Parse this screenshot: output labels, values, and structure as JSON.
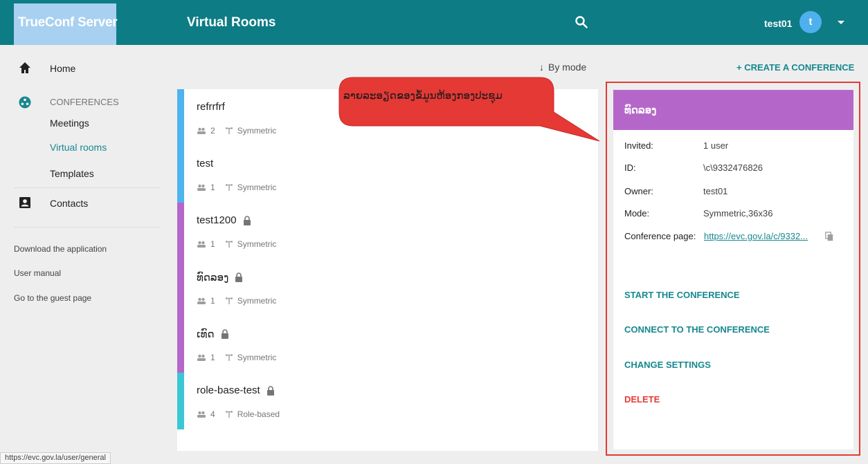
{
  "header": {
    "brand": "TrueConf Server",
    "title": "Virtual Rooms",
    "user": "test01",
    "avatar_letter": "t",
    "color": "#0d7c85",
    "brand_color": "#a8d0f0",
    "icons": [
      "search-icon",
      "dropdown-icon"
    ]
  },
  "sidebar": {
    "home": "Home",
    "conferences_section": "CONFERENCES",
    "meetings": "Meetings",
    "virtual_rooms": "Virtual rooms",
    "templates": "Templates",
    "contacts": "Contacts",
    "download": "Download the application",
    "user_manual": "User manual",
    "guest_page": "Go to the guest page",
    "icons": [
      "home-icon",
      "conferences-icon",
      "contacts-icon"
    ]
  },
  "toolbar": {
    "sort": "By mode",
    "create": "+ CREATE A CONFERENCE"
  },
  "rooms": [
    {
      "name": "refrrfrf",
      "participants": "2",
      "mode": "Symmetric",
      "locked": false,
      "color": "#4fb3ee"
    },
    {
      "name": "test",
      "participants": "1",
      "mode": "Symmetric",
      "locked": false,
      "color": "#4fb3ee"
    },
    {
      "name": "test1200",
      "participants": "1",
      "mode": "Symmetric",
      "locked": true,
      "color": "#b567c9"
    },
    {
      "name": "ທົດລອງ",
      "participants": "1",
      "mode": "Symmetric",
      "locked": true,
      "color": "#b567c9"
    },
    {
      "name": "ເທົດ",
      "participants": "1",
      "mode": "Symmetric",
      "locked": true,
      "color": "#b567c9"
    },
    {
      "name": "role-base-test",
      "participants": "4",
      "mode": "Role-based",
      "locked": true,
      "color": "#3cc7d6"
    }
  ],
  "detail": {
    "title": "ທົດລອງ",
    "header_color": "#b567c9",
    "invited_label": "Invited:",
    "invited": "1 user",
    "id_label": "ID:",
    "id": "\\c\\9332476826",
    "owner_label": "Owner:",
    "owner": "test01",
    "mode_label": "Mode:",
    "mode": "Symmetric,36x36",
    "page_label": "Conference page:",
    "page_url": "https://evc.gov.la/c/9332...",
    "start": "START THE CONFERENCE",
    "connect": "CONNECT TO THE CONFERENCE",
    "settings": "CHANGE SETTINGS",
    "delete": "DELETE",
    "accent": "#16888f",
    "danger": "#e53935"
  },
  "callout": {
    "text": "ລາຍລະອຽດຂອງຂໍ້ມູນຫ້ອງກອງປະຊຸມ",
    "color": "#e53935"
  },
  "status_bar": "https://evc.gov.la/user/general"
}
